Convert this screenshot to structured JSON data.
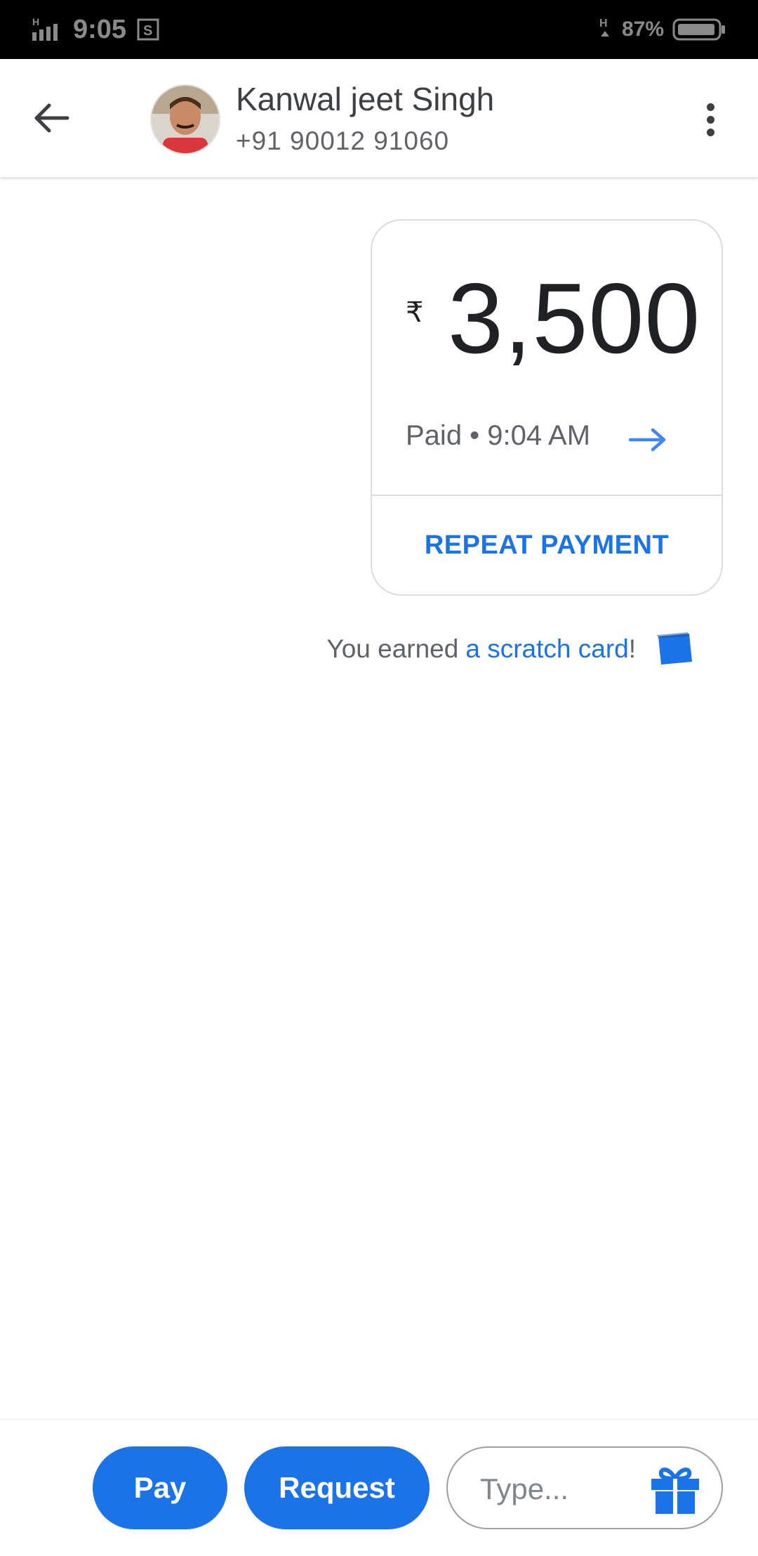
{
  "status_bar": {
    "time": "9:05",
    "battery": "87%"
  },
  "header": {
    "contact_name": "Kanwal jeet Singh",
    "contact_phone": "+91 90012 91060"
  },
  "payment": {
    "currency_symbol": "₹",
    "amount": "3,500",
    "status": "Paid • 9:04 AM",
    "repeat_label": "REPEAT PAYMENT"
  },
  "reward": {
    "prefix": "You earned ",
    "link_text": "a scratch card",
    "suffix": "!"
  },
  "bottom_bar": {
    "pay_label": "Pay",
    "request_label": "Request",
    "input_placeholder": "Type..."
  },
  "colors": {
    "accent": "#1a73e8",
    "text_primary": "#202124",
    "text_secondary": "#5f6368",
    "status_bar_bg": "#000000"
  },
  "icons": [
    "back-arrow-icon",
    "more-vert-icon",
    "right-arrow-icon",
    "scratch-card-icon",
    "gift-icon",
    "signal-icon",
    "battery-icon"
  ]
}
